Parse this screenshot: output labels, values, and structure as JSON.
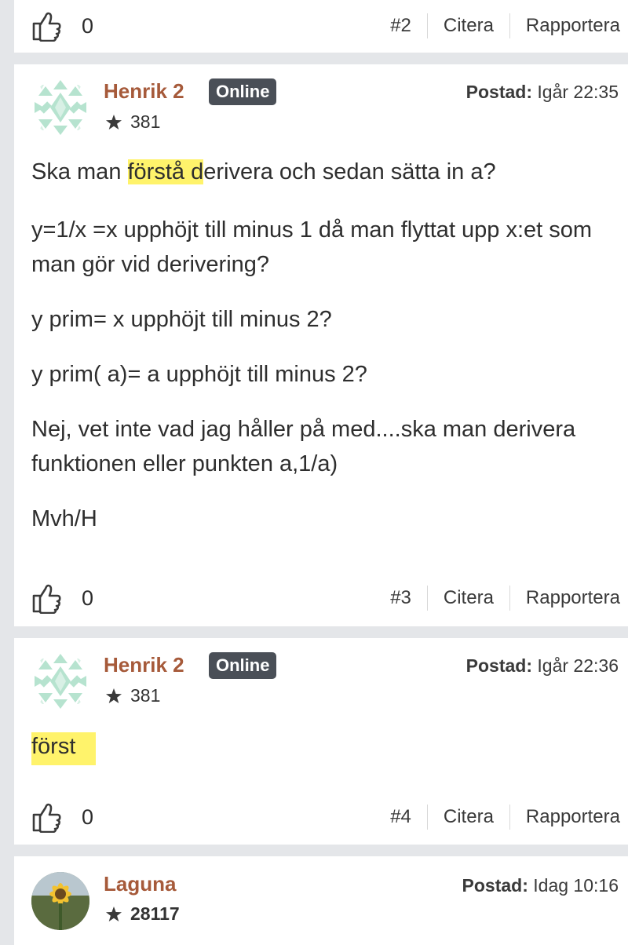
{
  "post2": {
    "likes": "0",
    "number": "#2",
    "quote": "Citera",
    "report": "Rapportera"
  },
  "post3": {
    "author": "Henrik 2",
    "badge": "Online",
    "reputation": "381",
    "posted_label": "Postad:",
    "posted_time": "Igår 22:35",
    "body": {
      "p1_pre": "Ska man ",
      "p1_highlight": "förstå d",
      "p1_post": "erivera och sedan sätta in a?",
      "p2": "y=1/x =x upphöjt till minus 1 då man flyttat upp x:et som man gör vid derivering?",
      "p3": "y prim= x upphöjt till minus 2?",
      "p4": "y prim( a)= a upphöjt till minus 2?",
      "p5": "Nej, vet inte vad jag håller på med....ska man derivera funktionen eller punkten a,1/a)",
      "p6": "Mvh/H"
    },
    "likes": "0",
    "number": "#3",
    "quote": "Citera",
    "report": "Rapportera"
  },
  "post4": {
    "author": "Henrik 2",
    "badge": "Online",
    "reputation": "381",
    "posted_label": "Postad:",
    "posted_time": "Igår 22:36",
    "body_highlight": "först",
    "likes": "0",
    "number": "#4",
    "quote": "Citera",
    "report": "Rapportera"
  },
  "post5": {
    "author": "Laguna",
    "reputation": "28117",
    "posted_label": "Postad:",
    "posted_time": "Idag 10:16"
  },
  "colors": {
    "author": "#a65a3a",
    "badge_bg": "#4a4f57",
    "highlight": "#fff36b",
    "page_bg": "#e4e6e9"
  },
  "icons": [
    "like-icon",
    "star-icon",
    "quilt-avatar-icon",
    "sunflower-avatar-icon"
  ]
}
